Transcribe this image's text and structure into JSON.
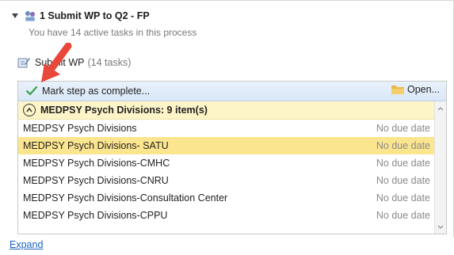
{
  "process": {
    "title": "1 Submit WP to Q2 - FP",
    "subtitle": "You have 14 active tasks in this process"
  },
  "step": {
    "name": "Submit WP",
    "count": "(14 tasks)"
  },
  "toolbar": {
    "mark_complete_label": "Mark step as complete...",
    "open_label": "Open..."
  },
  "group": {
    "title": "MEDPSY Psych Divisions: 9 item(s)"
  },
  "rows": [
    {
      "name": "MEDPSY Psych Divisions",
      "due": "No due date",
      "selected": false
    },
    {
      "name": "MEDPSY Psych Divisions- SATU",
      "due": "No due date",
      "selected": true
    },
    {
      "name": "MEDPSY Psych Divisions-CMHC",
      "due": "No due date",
      "selected": false
    },
    {
      "name": "MEDPSY Psych Divisions-CNRU",
      "due": "No due date",
      "selected": false
    },
    {
      "name": "MEDPSY Psych Divisions-Consultation Center",
      "due": "No due date",
      "selected": false
    },
    {
      "name": "MEDPSY Psych Divisions-CPPU",
      "due": "No due date",
      "selected": false
    }
  ],
  "footer": {
    "expand_label": "Expand"
  },
  "icons": {
    "collapse": "triangle-down-icon",
    "process": "workflow-people-icon",
    "step": "step-edit-icon",
    "check": "checkmark-icon",
    "folder": "folder-icon",
    "group_toggle": "chevron-up-circle-icon",
    "annotation": "red-arrow-icon"
  },
  "colors": {
    "selected_row": "#fce58f",
    "group_header": "#fdf4c8",
    "toolbar": "#d8e7f7",
    "link": "#1a64c0",
    "annotation_arrow": "#e8473a"
  }
}
